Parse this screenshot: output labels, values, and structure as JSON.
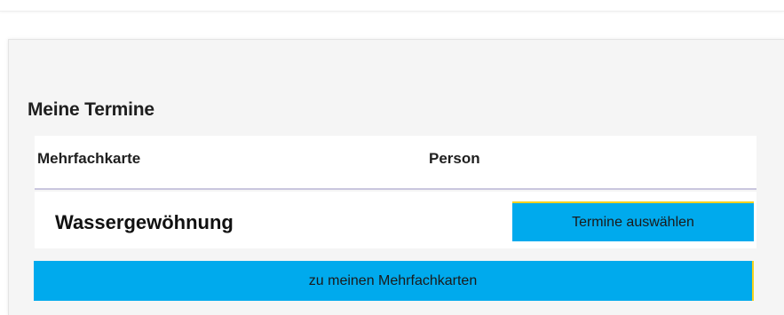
{
  "section": {
    "title": "Meine Termine"
  },
  "table": {
    "headers": [
      "Mehrfachkarte",
      "Person"
    ],
    "rows": [
      {
        "title": "Wassergewöhnung",
        "action_label": "Termine auswählen"
      }
    ]
  },
  "footer": {
    "button_label": "zu meinen Mehrfachkarten"
  },
  "colors": {
    "accent": "#00aaed",
    "highlight": "#f4d21f",
    "card_background": "#f5f5f5"
  }
}
